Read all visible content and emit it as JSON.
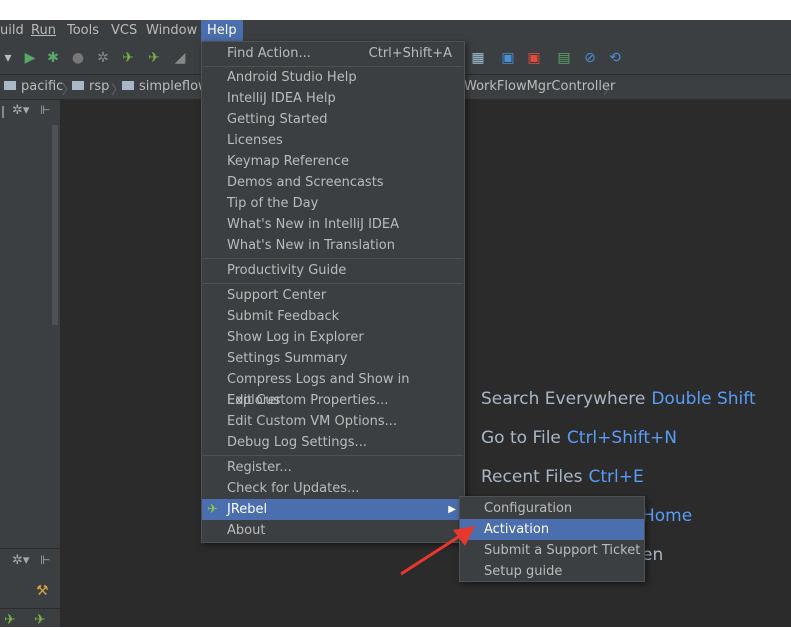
{
  "menubar": {
    "items": [
      "uild",
      "Run",
      "Tools",
      "VCS",
      "Window",
      "Help"
    ]
  },
  "breadcrumb": {
    "items": [
      "pacific",
      "rsp",
      "simpleflow",
      "WorkFlowMgrController"
    ]
  },
  "help_menu": {
    "find_action": "Find Action...",
    "find_action_shortcut": "Ctrl+Shift+A",
    "items_group1": [
      "Android Studio Help",
      "IntelliJ IDEA Help",
      "Getting Started",
      "Licenses",
      "Keymap Reference",
      "Demos and Screencasts",
      "Tip of the Day",
      "What's New in IntelliJ IDEA",
      "What's New in Translation"
    ],
    "productivity": "Productivity Guide",
    "items_group3": [
      "Support Center",
      "Submit Feedback",
      "Show Log in Explorer",
      "Settings Summary",
      "Compress Logs and Show in Explorer",
      "Edit Custom Properties...",
      "Edit Custom VM Options...",
      "Debug Log Settings..."
    ],
    "items_group4": [
      "Register...",
      "Check for Updates..."
    ],
    "jrebel": "JRebel",
    "about": "About"
  },
  "jrebel_submenu": {
    "items": [
      "Configuration",
      "Activation",
      "Submit a Support Ticket",
      "Setup guide"
    ],
    "selected": "Activation"
  },
  "editor_hints": {
    "search_label": "Search Everywhere",
    "search_key": "Double Shift",
    "goto_label": "Go to File",
    "goto_key": "Ctrl+Shift+N",
    "recent_label": "Recent Files",
    "recent_key": "Ctrl+E",
    "partial1": "Home",
    "partial2": "en"
  },
  "colors": {
    "accent": "#4b6eaf",
    "menu_bg": "#3c3f41",
    "editor_bg": "#2b2b2b",
    "hint_key": "#589df6",
    "arrow": "#e8372c"
  }
}
